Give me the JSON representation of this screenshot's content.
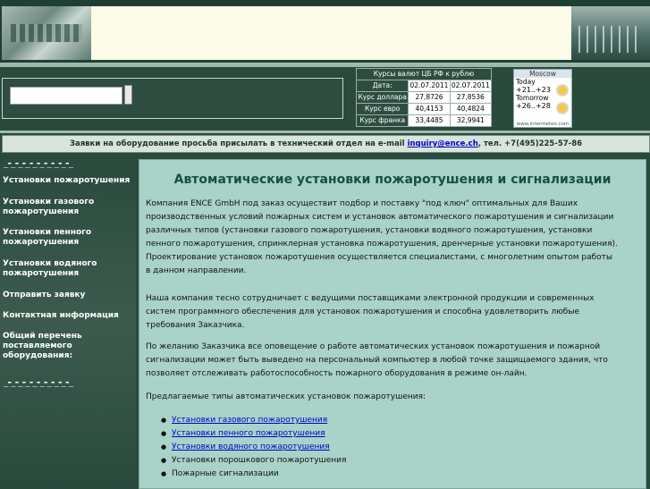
{
  "rates": {
    "caption": "Курсы валют ЦБ РФ к рублю",
    "date_label": "Дата:",
    "date1": "02.07.2011",
    "date2": "02.07.2011",
    "rows": [
      {
        "label": "Курс доллара",
        "v1": "27,8726",
        "v2": "27,8536"
      },
      {
        "label": "Курс евро",
        "v1": "40,4153",
        "v2": "40,4824"
      },
      {
        "label": "Курс франка",
        "v1": "33,4485",
        "v2": "32,9941"
      }
    ]
  },
  "weather": {
    "city": "Moscow",
    "today_label": "Today",
    "today_temp": "+21..+23",
    "tomorrow_label": "Tomorrow",
    "tomorrow_temp": "+26..+28",
    "source": "www.intermeteo.com"
  },
  "notice": {
    "text": "Заявки на оборудование просьба присылать в технический отдел на e-mail ",
    "email": "inquiry@ence.ch",
    "phone": ", тел. +7(495)225-57-86"
  },
  "sidebar": {
    "dash": "_-_-_-_-_-_-_-_-_-_",
    "items": [
      {
        "label": "Установки пожаротушения"
      },
      {
        "label": "Установки газового пожаротушения"
      },
      {
        "label": "Установки пенного пожаротушения"
      },
      {
        "label": "Установки водяного пожаротушения"
      },
      {
        "label": "Отправить заявку"
      },
      {
        "label": "Контактная информация"
      },
      {
        "label": "Общий перечень поставляемого оборудования:"
      }
    ]
  },
  "main": {
    "title": "Автоматические установки пожаротушения и сигнализации",
    "p1": "Компания ENCE GmbH под заказ осуществит подбор и поставку \"под ключ\" оптимальных для Ваших производственных условий пожарных систем и установок автоматического пожаротушения и сигнализации различных типов (установки газового пожаротушения, установки водяного пожаротушения, установки пенного пожаротушения, спринклерная установка пожаротушения, дренчерные установки пожаротушения). Проектирование установок пожаротушения осуществляется специалистами, с многолетним опытом работы в данном направлении.",
    "p2": "Наша компания тесно сотрудничает с ведущими поставщиками электронной продукции и современных систем программного обеспечения для установок пожаротушения и способна удовлетворить любые требования Заказчика.",
    "p3": "По желанию Заказчика все оповещение о работе автоматических установок пожаротушения и пожарной сигнализации может быть выведено на персональный компьютер в любой точке защищаемого здания, что позволяет отслеживать работоспособность пожарного оборудования в режиме он-лайн.",
    "p4": "Предлагаемые типы автоматических установок пожаротушения:",
    "list": [
      {
        "label": "Установки газового пожаротушения"
      },
      {
        "label": "Установки пенного пожаротушения"
      },
      {
        "label": "Установки водяного пожаротушения"
      },
      {
        "label": "Установки порошкового пожаротушения"
      },
      {
        "label": "Пожарные сигнализации"
      }
    ]
  }
}
